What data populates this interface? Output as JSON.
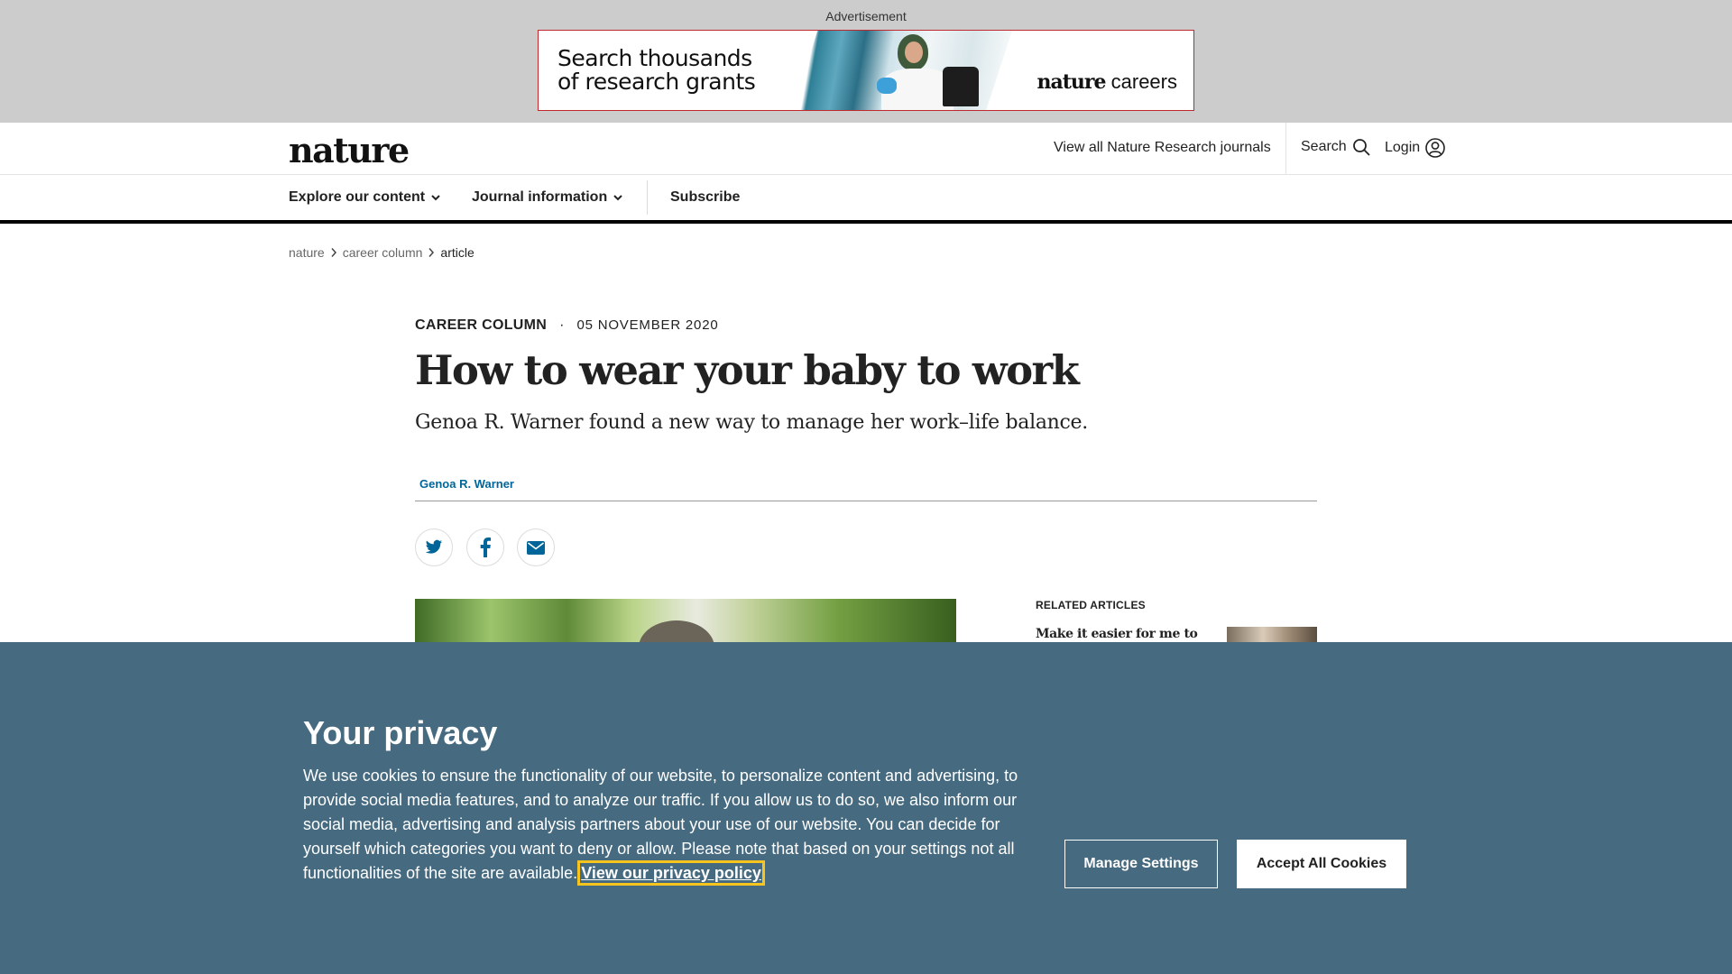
{
  "ad": {
    "label": "Advertisement",
    "headline_line1": "Search thousands",
    "headline_line2": "of research grants",
    "brand_bold": "nature",
    "brand_regular": " careers"
  },
  "header": {
    "logo": "nature",
    "journals_link": "View all Nature Research journals",
    "search_label": "Search",
    "login_label": "Login"
  },
  "nav": {
    "explore": "Explore our content",
    "journal_info": "Journal information",
    "subscribe": "Subscribe"
  },
  "breadcrumb": {
    "items": [
      "nature",
      "career column",
      "article"
    ]
  },
  "article": {
    "type": "CAREER COLUMN",
    "separator": "·",
    "date": "05 NOVEMBER 2020",
    "title": "How to wear your baby to work",
    "standfirst": "Genoa R. Warner found a new way to manage her work–life balance.",
    "author": "Genoa R. Warner"
  },
  "share": {
    "icons": [
      "twitter-icon",
      "facebook-icon",
      "email-icon"
    ]
  },
  "related": {
    "heading": "RELATED ARTICLES",
    "first_title": "Make it easier for me to"
  },
  "cookie": {
    "title": "Your privacy",
    "body": "We use cookies to ensure the functionality of our website, to personalize content and advertising, to provide social media features, and to analyze our traffic. If you allow us to do so, we also inform our social media, advertising and analysis partners about your use of our website. You can decide for yourself which categories you want to deny or allow. Please note that based on your settings not all functionalities of the site are available.",
    "policy_link": "View our privacy policy",
    "manage_button": "Manage Settings",
    "accept_button": "Accept All Cookies"
  },
  "colors": {
    "ad_band": "#cccccc",
    "link_blue": "#006699",
    "cookie_bg": "#466a7f",
    "focus_outline": "#f7c51e"
  }
}
